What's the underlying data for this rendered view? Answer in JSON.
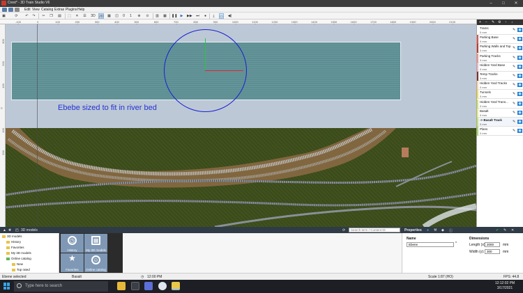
{
  "window": {
    "title": "Crest* - 3D Train Studio V6"
  },
  "menu": [
    "Edit",
    "View",
    "Catalog",
    "Extras",
    "Plugins",
    "Help"
  ],
  "toolbar": {
    "view_2d3d": [
      "3D",
      "2D"
    ],
    "layer_number": "0",
    "zoom_number": "1"
  },
  "ruler_ticks": [
    "-100",
    "0",
    "100",
    "200",
    "300",
    "400",
    "500",
    "600",
    "700",
    "800",
    "900",
    "1000",
    "1100",
    "1200",
    "1300",
    "1400",
    "1500",
    "1600",
    "1700",
    "1800",
    "1900",
    "2000",
    "2100"
  ],
  "vruler_ticks": [
    "300",
    "200",
    "100",
    "0",
    "100",
    "200"
  ],
  "canvas": {
    "caption": "Ebebe sized to fit in river bed"
  },
  "layers": [
    {
      "name": "Trams",
      "height": "0 mm",
      "color": "#ffffff"
    },
    {
      "name": "Parking Base",
      "height": "0 mm",
      "color": "#d9534f"
    },
    {
      "name": "Parking Walls and Top",
      "height": "0 mm",
      "color": "#c0392b"
    },
    {
      "name": "Parking Tracks",
      "height": "0 mm",
      "color": "#f1948a"
    },
    {
      "name": "Hidden Yard Base",
      "height": "0 mm",
      "color": "#e6b8c8"
    },
    {
      "name": "Temp Tracks",
      "height": "0 mm",
      "color": "#7b2f2f"
    },
    {
      "name": "Hidden Yard Tracks",
      "height": "0 mm",
      "color": "#f7d7a8"
    },
    {
      "name": "Tunnels",
      "height": "0 mm",
      "color": "#f4e04d"
    },
    {
      "name": "Hidden Yard Trans...",
      "height": "0 mm",
      "color": "#d4e86a"
    },
    {
      "name": "Basalt",
      "height": "0 mm",
      "color": "#e6f07a"
    },
    {
      "name": "-> Basalt Track",
      "height": "0 mm",
      "color": "#c8e66a",
      "selected": true
    },
    {
      "name": "Plans",
      "height": "0 mm",
      "color": "#a8d86a"
    }
  ],
  "bottom": {
    "models_title": "3D models",
    "search_placeholder": "Search term / Content ID",
    "properties_title": "Properties"
  },
  "tree": [
    "3D models",
    "History",
    "Favorites",
    "My 3D models",
    "Online catalog",
    "New",
    "Top rated"
  ],
  "tiles": [
    "History",
    "My 3D models",
    "Favorites",
    "Online catalog"
  ],
  "properties": {
    "name_label": "Name",
    "name_value": "Ebene",
    "dimensions_label": "Dimensions",
    "length_label": "Length (x):",
    "length_value": "2000",
    "width_label": "Width (y):",
    "width_value": "300",
    "unit": "mm"
  },
  "status": {
    "selection": "Ebene selected",
    "layer": "Basalt",
    "time": "12:00 PM",
    "scale": "Scale 1:87 (HO)",
    "fps": "FPS: 44.8"
  },
  "taskbar": {
    "search_placeholder": "Type here to search",
    "clock_time": "12:12:02 PM",
    "clock_date": "3/17/2021"
  },
  "colors": {
    "caption": "#2433d0",
    "circle": "#1a1fd0",
    "accent": "#1b7fd6"
  }
}
